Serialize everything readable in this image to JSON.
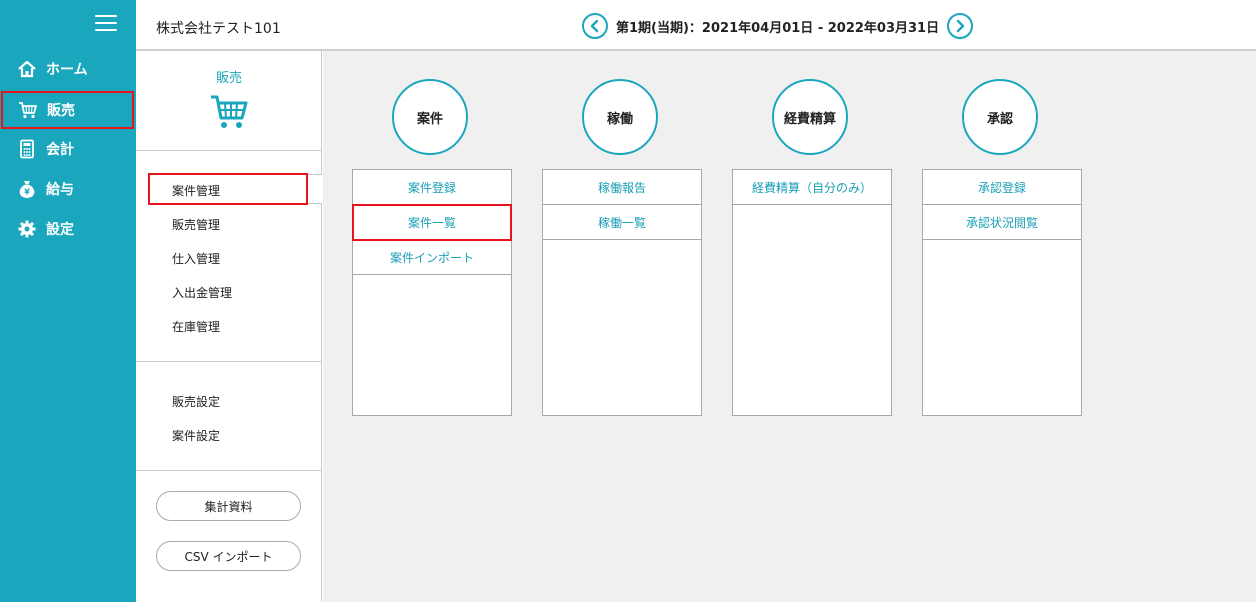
{
  "nav": {
    "items": [
      {
        "label": "ホーム",
        "icon": "home-icon"
      },
      {
        "label": "販売",
        "icon": "cart-icon"
      },
      {
        "label": "会計",
        "icon": "calculator-icon"
      },
      {
        "label": "給与",
        "icon": "money-bag-icon"
      },
      {
        "label": "設定",
        "icon": "gear-icon"
      }
    ],
    "selected": "販売"
  },
  "header": {
    "company": "株式会社テスト101",
    "period": "第1期(当期)：2021年04月01日 - 2022年03月31日"
  },
  "subnav": {
    "title": "販売",
    "group1": [
      "案件管理",
      "販売管理",
      "仕入管理",
      "入出金管理",
      "在庫管理"
    ],
    "group2": [
      "販売設定",
      "案件設定"
    ],
    "buttons": [
      "集計資料",
      "CSV インポート"
    ],
    "selected": "案件管理"
  },
  "main": {
    "categories": [
      {
        "title": "案件",
        "items": [
          "案件登録",
          "案件一覧",
          "案件インポート"
        ]
      },
      {
        "title": "稼働",
        "items": [
          "稼働報告",
          "稼働一覧"
        ]
      },
      {
        "title": "経費精算",
        "items": [
          "経費精算（自分のみ）"
        ]
      },
      {
        "title": "承認",
        "items": [
          "承認登録",
          "承認状況閲覧"
        ]
      }
    ],
    "highlighted_item": "案件一覧"
  },
  "colors": {
    "accent": "#1aa6bd",
    "highlight": "#e8141c",
    "main_bg": "#f0f0f0"
  }
}
